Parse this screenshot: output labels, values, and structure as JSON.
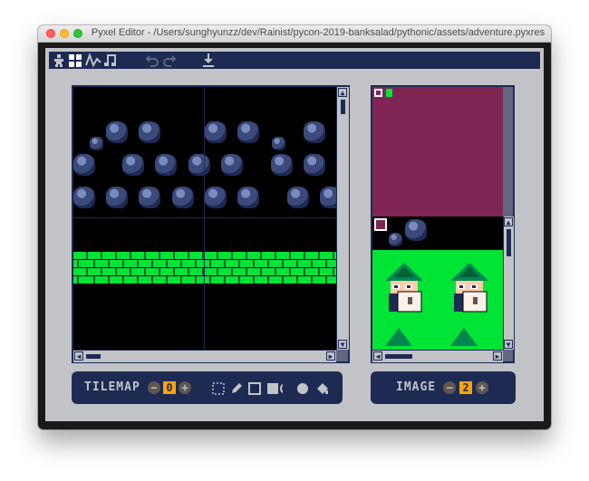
{
  "window": {
    "title": "Pyxel Editor - /Users/sunghyunzz/dev/Rainist/pycon-2019-banksalad/pythonic/assets/adventure.pyxres"
  },
  "toolbar": {
    "tabs": [
      {
        "name": "image-editor",
        "icon": "figure-icon"
      },
      {
        "name": "tilemap-editor",
        "icon": "grid-icon"
      },
      {
        "name": "sound-editor",
        "icon": "wave-icon"
      },
      {
        "name": "music-editor",
        "icon": "music-note-icon"
      }
    ],
    "undo_icon": "undo-icon",
    "redo_icon": "redo-icon",
    "save_icon": "download-icon"
  },
  "tilemap_panel": {
    "label": "TILEMAP",
    "value": "0",
    "tools": [
      "select-icon",
      "pencil-icon",
      "rect-outline-icon",
      "rect-fill-icon",
      "circle-outline-icon",
      "circle-fill-icon",
      "bucket-icon"
    ]
  },
  "image_panel": {
    "label": "IMAGE",
    "value": "2"
  },
  "colors": {
    "navy": "#1d2b53",
    "gray": "#c2c3c7",
    "purple": "#7e2553",
    "green": "#00e436",
    "orange": "#ffa300"
  }
}
